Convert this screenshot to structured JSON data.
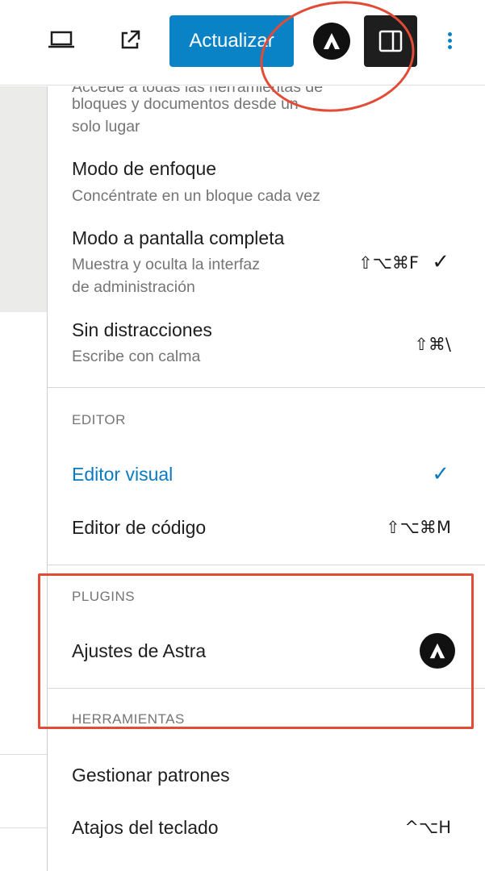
{
  "toolbar": {
    "update_label": "Actualizar",
    "icons": {
      "device": "desktop-preview-icon",
      "external": "external-link-icon",
      "plugin": "astra-logo-icon",
      "settings": "settings-sidebar-icon",
      "more": "more-vertical-icon"
    },
    "accent_color": "#0a82c6"
  },
  "menu": {
    "view_section": {
      "top_item": {
        "description": "Accede a todas las herramientas de bloques y documentos desde un solo lugar",
        "description_lines": [
          "Accede a todas las herramientas de",
          "bloques y documentos desde un",
          "solo lugar"
        ]
      },
      "items": [
        {
          "label": "Modo de enfoque",
          "description": "Concéntrate en un bloque cada vez",
          "shortcut": "",
          "checked": false
        },
        {
          "label": "Modo a pantalla completa",
          "description_lines": [
            "Muestra y oculta la interfaz",
            "de administración"
          ],
          "shortcut": "⇧⌥⌘F",
          "checked": true
        },
        {
          "label": "Sin distracciones",
          "description": "Escribe con calma",
          "shortcut": "⇧⌘\\",
          "checked": false
        }
      ]
    },
    "editor_section": {
      "heading": "EDITOR",
      "items": [
        {
          "label": "Editor visual",
          "checked": true,
          "active_color": "#0a7bc1"
        },
        {
          "label": "Editor de código",
          "shortcut": "⇧⌥⌘M"
        }
      ]
    },
    "plugins_section": {
      "heading": "PLUGINS",
      "items": [
        {
          "label": "Ajustes de Astra",
          "icon": "astra-logo-icon"
        }
      ]
    },
    "tools_section": {
      "heading": "HERRAMIENTAS",
      "items": [
        {
          "label": "Gestionar patrones"
        },
        {
          "label": "Atajos del teclado",
          "shortcut": "^⌥H"
        }
      ]
    },
    "check_glyph": "✓"
  },
  "annotation_color": "#e24b35"
}
